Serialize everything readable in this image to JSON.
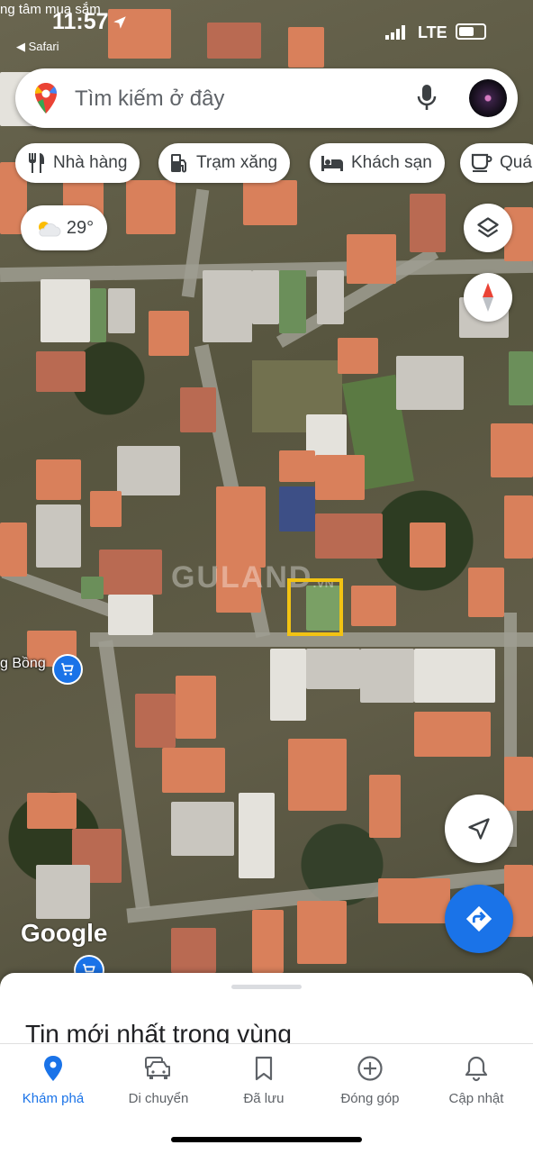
{
  "status_bar": {
    "ticker": "ng tâm mua sắm",
    "time": "11:57",
    "back_label": "◀ Safari",
    "network": "LTE"
  },
  "search": {
    "placeholder": "Tìm kiếm ở đây"
  },
  "chips": [
    {
      "label": "Nhà hàng",
      "icon": "restaurant-icon"
    },
    {
      "label": "Trạm xăng",
      "icon": "gas-station-icon"
    },
    {
      "label": "Khách sạn",
      "icon": "hotel-icon"
    },
    {
      "label": "Quá",
      "icon": "coffee-icon"
    }
  ],
  "weather": {
    "temp": "29°",
    "icon": "partly-cloudy-icon"
  },
  "map": {
    "watermark": "GULAND",
    "watermark_suffix": ".VN",
    "poi_label": "g Bồng",
    "logo": "Google"
  },
  "sheet": {
    "title": "Tin mới nhất trong vùng"
  },
  "tabs": [
    {
      "label": "Khám phá",
      "icon": "explore-pin-icon",
      "active": true
    },
    {
      "label": "Di chuyển",
      "icon": "car-icon",
      "active": false
    },
    {
      "label": "Đã lưu",
      "icon": "bookmark-icon",
      "active": false
    },
    {
      "label": "Đóng góp",
      "icon": "add-circle-icon",
      "active": false
    },
    {
      "label": "Cập nhật",
      "icon": "bell-icon",
      "active": false
    }
  ],
  "colors": {
    "accent": "#1a73e8",
    "highlight_box": "#f2c313",
    "compass_red": "#ea4335"
  }
}
